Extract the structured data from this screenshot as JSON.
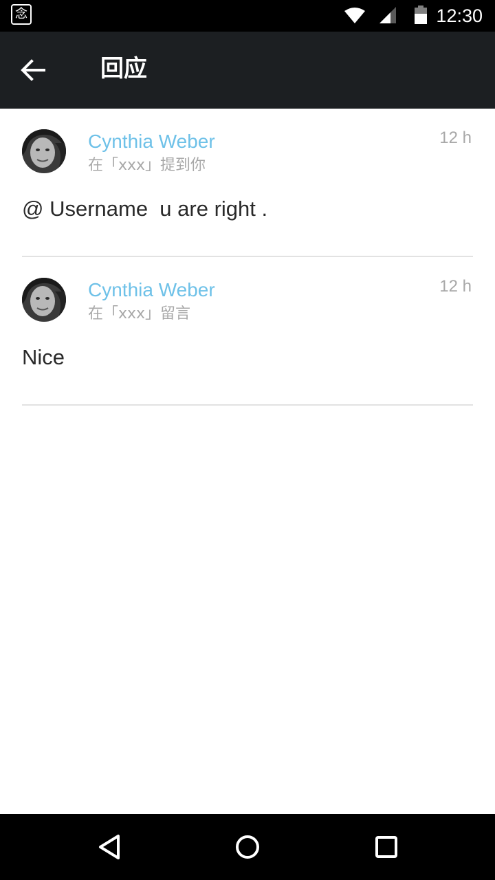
{
  "status_bar": {
    "app_icon_glyph": "念",
    "time": "12:30",
    "icons": [
      "wifi-icon",
      "signal-icon",
      "battery-icon"
    ]
  },
  "toolbar": {
    "title": "回应",
    "back_icon": "arrow-left-icon"
  },
  "colors": {
    "toolbar_bg": "#1c1f22",
    "author": "#6ec1e8",
    "meta": "#a8a8a8",
    "text": "#2a2a2a"
  },
  "notifications": [
    {
      "author": "Cynthia Weber",
      "context": "在「xxx」提到你",
      "time": "12 h",
      "message": "@ Username  u are right ."
    },
    {
      "author": "Cynthia Weber",
      "context": "在「xxx」留言",
      "time": "12 h",
      "message": "Nice"
    }
  ],
  "nav_bar": {
    "icons": [
      "back-triangle-icon",
      "home-circle-icon",
      "recents-square-icon"
    ]
  }
}
